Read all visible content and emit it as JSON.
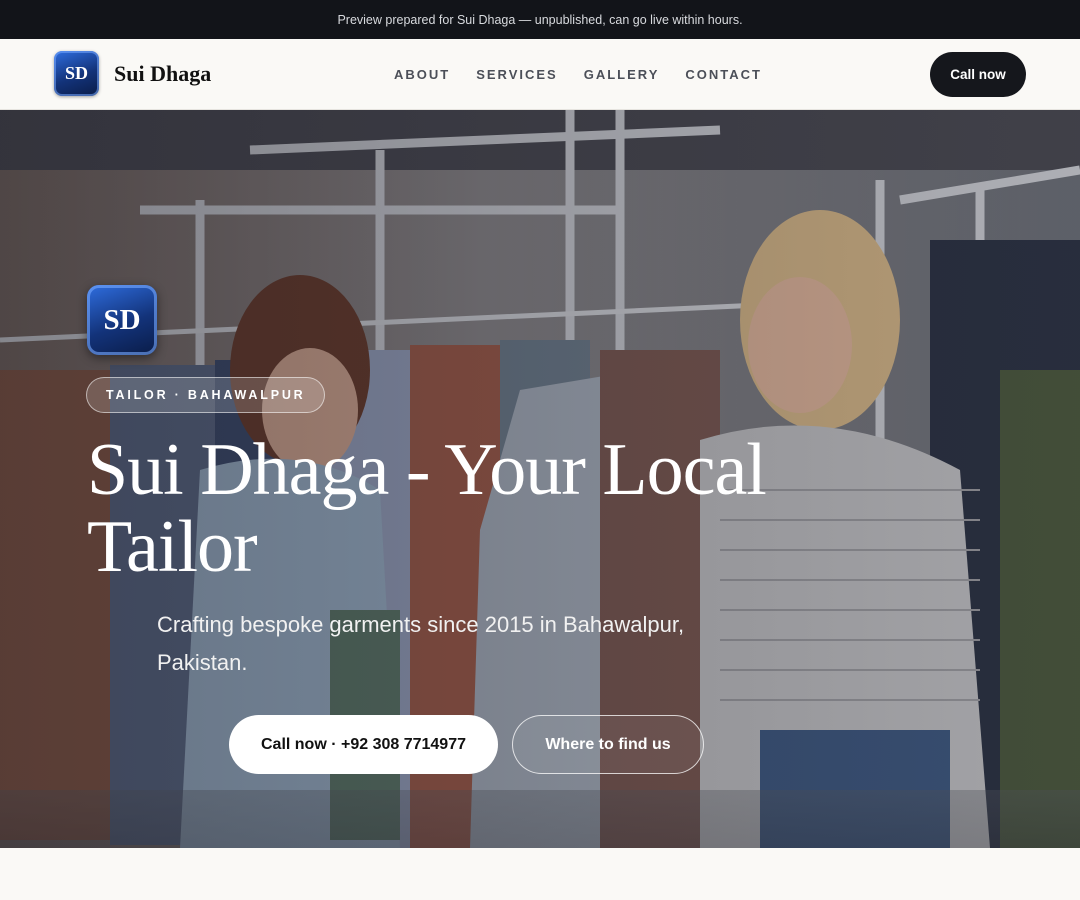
{
  "preview_banner": {
    "text": "Preview prepared for Sui Dhaga — unpublished, can go live within hours."
  },
  "header": {
    "logo_text": "SD",
    "brand_name": "Sui Dhaga",
    "nav": [
      {
        "label": "ABOUT"
      },
      {
        "label": "SERVICES"
      },
      {
        "label": "GALLERY"
      },
      {
        "label": "CONTACT"
      }
    ],
    "cta_label": "Call now"
  },
  "hero": {
    "logo_text": "SD",
    "tag": "TAILOR · BAHAWALPUR",
    "title": "Sui Dhaga - Your Local Tailor",
    "subtitle": "Crafting bespoke garments since 2015 in Bahawalpur, Pakistan.",
    "primary_button": "Call now · +92 308 7714977",
    "secondary_button": "Where to find us"
  },
  "colors": {
    "preview_bar_bg": "#121419",
    "nav_bg": "#faf9f6",
    "nav_cta_bg": "#15171c",
    "logo_blue": "#13337a",
    "nav_link": "#4b4f58",
    "page_bg": "#faf9f6"
  }
}
